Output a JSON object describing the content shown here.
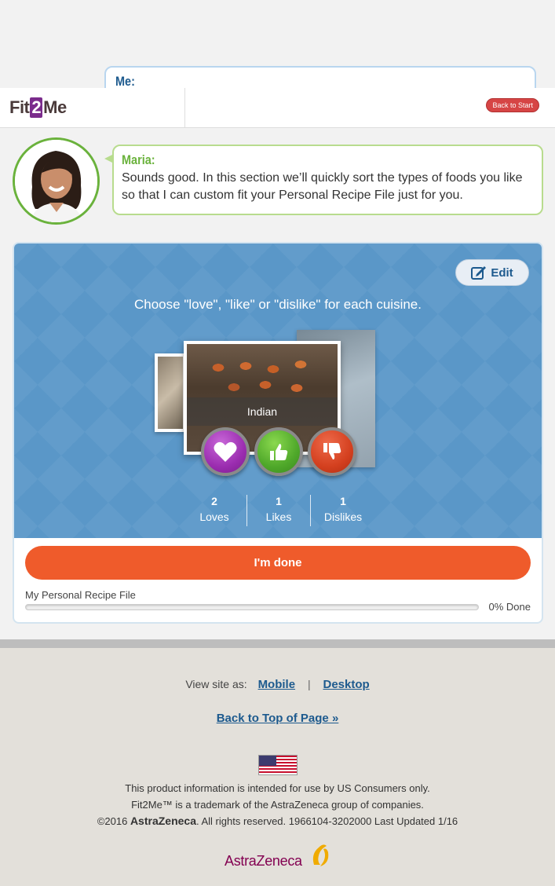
{
  "me_bubble": {
    "name": "Me:"
  },
  "header": {
    "logo": {
      "part1": "Fit",
      "part2": "2",
      "part3": "Me"
    },
    "back_to_start": "Back to Start"
  },
  "maria": {
    "name": "Maria:",
    "message": "Sounds good. In this section we’ll quickly sort the types of foods you like so that I can custom fit your Personal Recipe File just for you."
  },
  "panel": {
    "edit_label": "Edit",
    "instruction": "Choose \"love\", \"like\" or \"dislike\" for each cuisine.",
    "current_card": "Indian",
    "counts": [
      {
        "value": "2",
        "label": "Loves"
      },
      {
        "value": "1",
        "label": "Likes"
      },
      {
        "value": "1",
        "label": "Dislikes"
      }
    ],
    "done_label": "I'm done",
    "progress": {
      "label": "My Personal Recipe File",
      "percent": 0,
      "text": "0% Done"
    }
  },
  "footer": {
    "view_site_label": "View site as:",
    "mobile": "Mobile",
    "separator": "|",
    "desktop": "Desktop",
    "back_to_top": "Back to Top of Page »",
    "legal_line1": "This product information is intended for use by US Consumers only.",
    "legal_line2": "Fit2Me™ is a trademark of the AstraZeneca group of companies.",
    "legal_line3_pre": "©2016 ",
    "legal_line3_brand": "AstraZeneca",
    "legal_line3_post": ". All rights reserved. 1966104-3202000 Last Updated 1/16",
    "brand_logo_text": "AstraZeneca"
  },
  "colors": {
    "accent_orange": "#ef5b2b",
    "panel_blue": "#5a97c8",
    "maria_green": "#6ab23c",
    "link_blue": "#1d5a8e",
    "love_purple": "#9b2db0",
    "like_green": "#4fa82a",
    "dislike_red": "#d4401f"
  }
}
